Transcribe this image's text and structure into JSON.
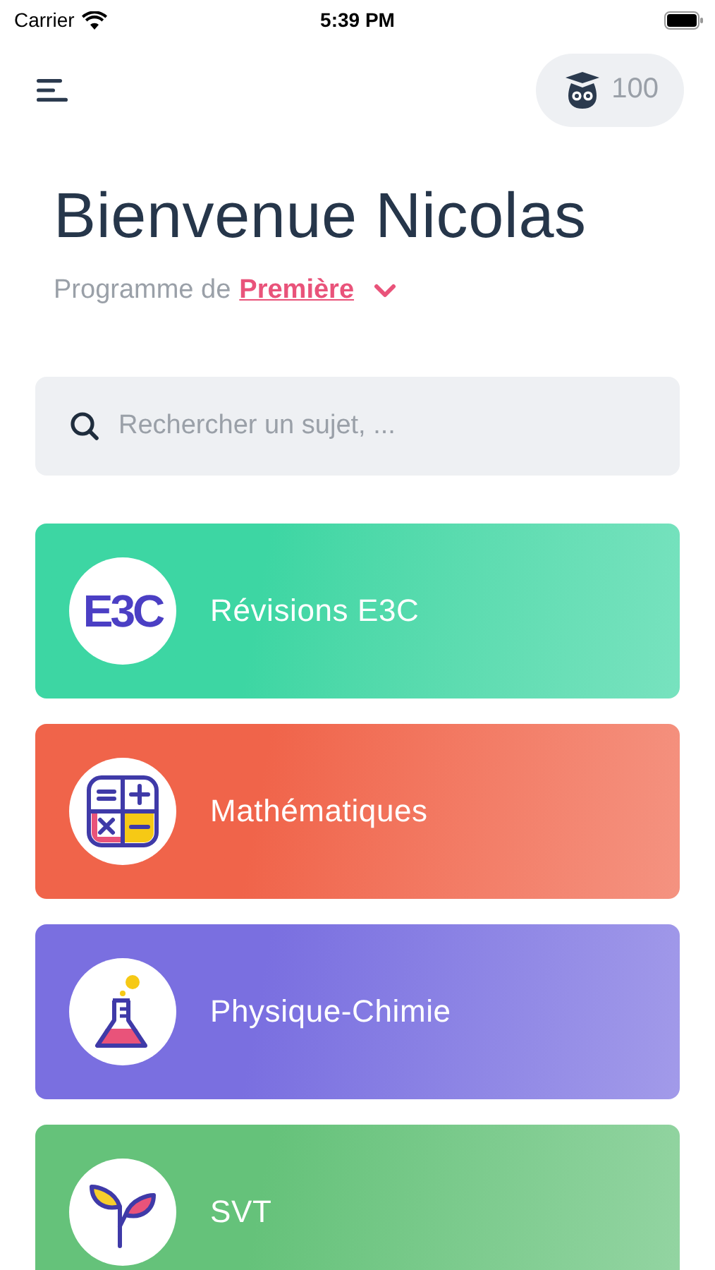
{
  "status_bar": {
    "carrier": "Carrier",
    "time": "5:39 PM"
  },
  "header": {
    "points": "100"
  },
  "title": "Bienvenue Nicolas",
  "program": {
    "label": "Programme de",
    "level": "Première"
  },
  "search": {
    "placeholder": "Rechercher un sujet, ..."
  },
  "subjects": [
    {
      "kind": "e3c",
      "icon_text": "E3C",
      "label": "Révisions E3C",
      "color": "#3dd6a3"
    },
    {
      "kind": "calc",
      "label": "Mathématiques",
      "color": "#f0644a"
    },
    {
      "kind": "flask",
      "label": "Physique-Chimie",
      "color": "#7a6fe0"
    },
    {
      "kind": "plant",
      "label": "SVT",
      "color": "#65c27a"
    }
  ]
}
